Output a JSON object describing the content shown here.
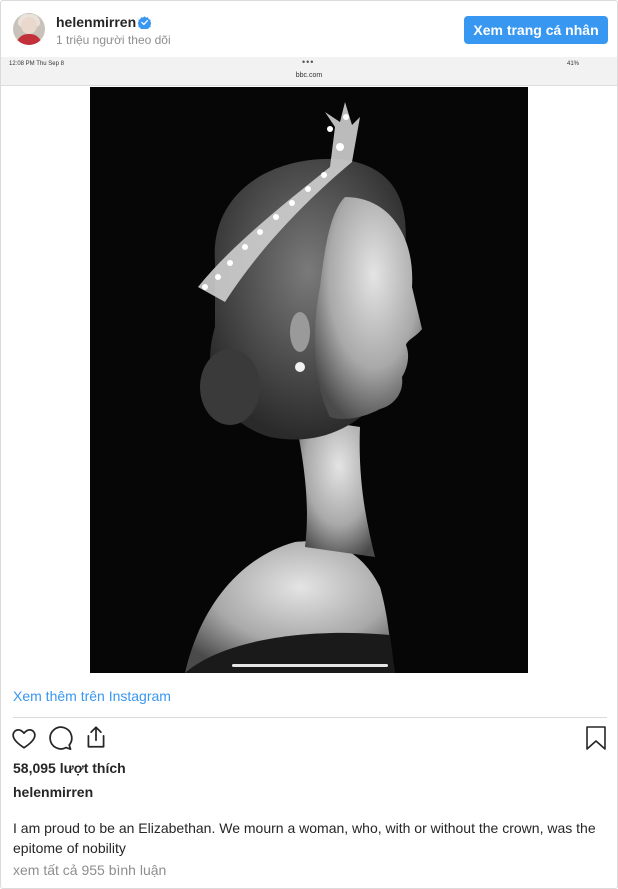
{
  "header": {
    "username": "helenmirren",
    "followers": "1 triệu người theo dõi",
    "view_profile_label": "Xem trang cá nhân"
  },
  "media": {
    "status_time": "12:08 PM  Thu Sep 8",
    "status_dots": "•••",
    "status_url": "bbc.com",
    "status_right": "41%"
  },
  "footer": {
    "more_link": "Xem thêm trên Instagram",
    "likes": "58,095 lượt thích",
    "caption_username": "helenmirren",
    "caption_text": "I am proud to be an Elizabethan. We mourn a woman, who, with or without the crown, was the epitome of nobility",
    "view_comments": "xem tất cả 955 bình luận"
  },
  "colors": {
    "accent": "#3897f0",
    "text": "#262626",
    "muted": "#8e8e8e",
    "border": "#dbdbdb"
  },
  "icons": [
    "verified-badge-icon",
    "heart-icon",
    "comment-icon",
    "share-icon",
    "bookmark-icon"
  ]
}
